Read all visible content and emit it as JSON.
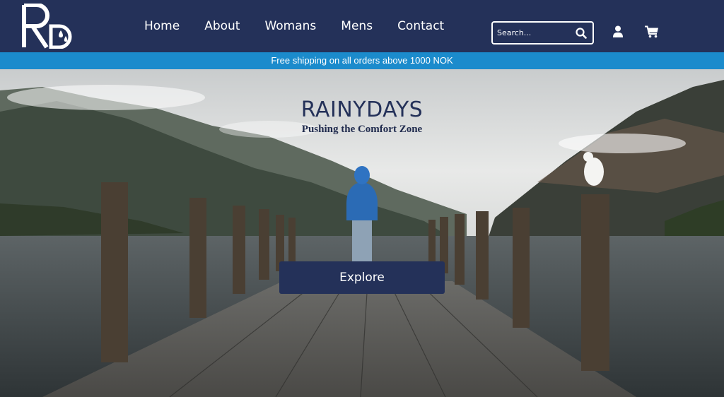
{
  "brand": {
    "logo_text": "RD",
    "colors": {
      "primary": "#243159",
      "accent": "#1b8bcc",
      "text": "#ffffff"
    }
  },
  "nav": {
    "items": [
      {
        "label": "Home"
      },
      {
        "label": "About"
      },
      {
        "label": "Womans"
      },
      {
        "label": "Mens"
      },
      {
        "label": "Contact"
      }
    ]
  },
  "search": {
    "placeholder": "Search...",
    "icon": "search-icon"
  },
  "header_icons": {
    "account": "user-icon",
    "cart": "cart-icon"
  },
  "promo": {
    "text": "Free shipping on all orders above 1000 NOK"
  },
  "hero": {
    "title": "RAINYDAYS",
    "subtitle": "Pushing the Comfort Zone",
    "cta_label": "Explore"
  }
}
